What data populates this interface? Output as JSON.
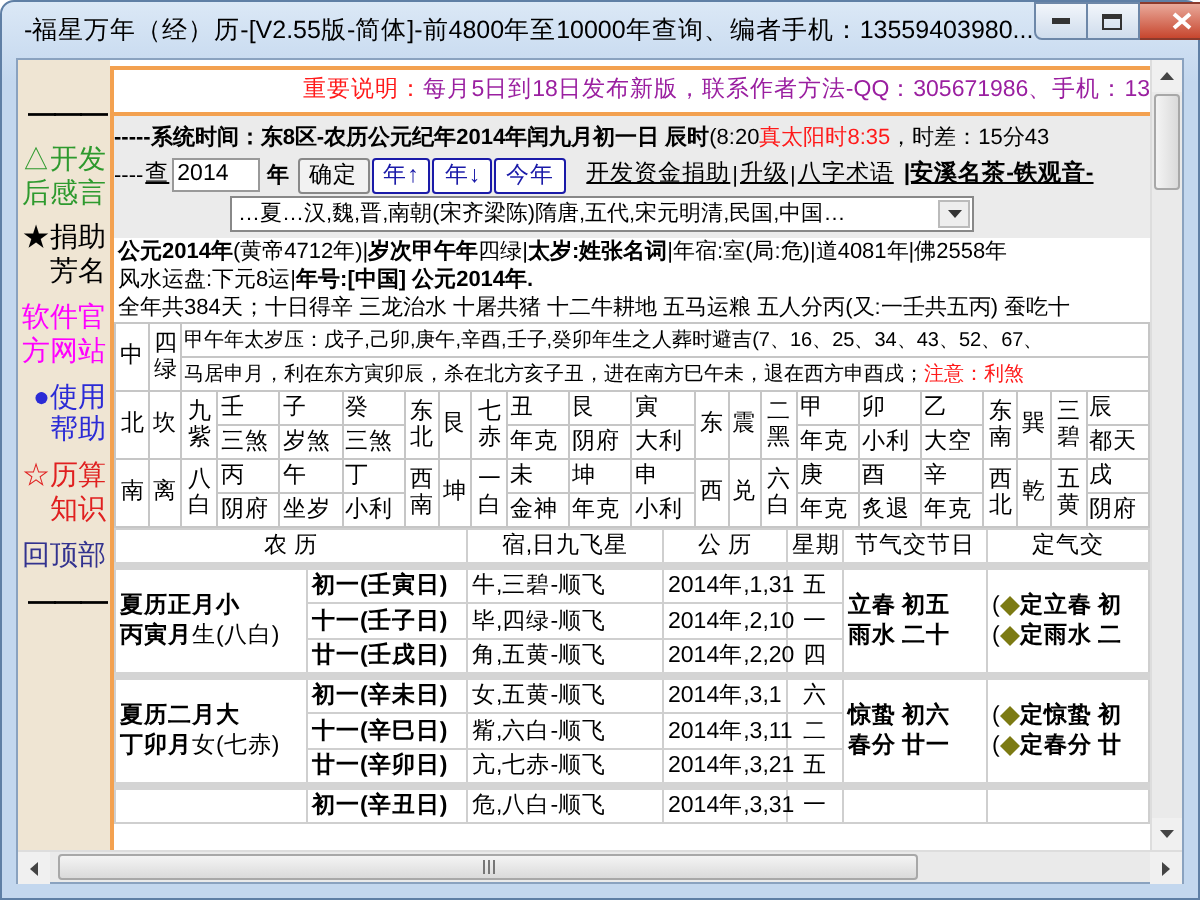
{
  "window": {
    "title": "-福星万年（经）历-[V2.55版-简体]-前4800年至10000年查询、编者手机：13559403980..."
  },
  "sidebar": {
    "items": [
      {
        "kind": "rule",
        "text": "———",
        "color": "#000000"
      },
      {
        "kind": "link",
        "text": "△开发后感言",
        "color": "#2e9a2e"
      },
      {
        "kind": "link",
        "text": "★捐助芳名",
        "color": "#000000"
      },
      {
        "kind": "link",
        "text": "软件官方网站",
        "color": "#ff00ff"
      },
      {
        "kind": "link",
        "text": "●使用帮助",
        "color": "#2b2bd6"
      },
      {
        "kind": "link",
        "text": "☆历算知识",
        "color": "#e02020"
      },
      {
        "kind": "link",
        "text": "回顶部",
        "color": "#33338f"
      },
      {
        "kind": "rule",
        "text": "———",
        "color": "#000000"
      }
    ]
  },
  "notice": {
    "label": "重要说明：",
    "text": "每月5日到18日发布新版，联系作者方法-QQ：305671986、手机：13"
  },
  "system_time": {
    "label": "-----系统时间：东8区-农历公元纪年2014年闰九月初一日 辰时",
    "clock": "(8:20",
    "solar_time": "真太阳时8:35",
    "offset": "，时差：15分43"
  },
  "query": {
    "prefix": "----",
    "label": "查",
    "year": "2014",
    "unit": "年",
    "buttons": [
      {
        "label": "确定",
        "kind": "confirm"
      },
      {
        "label": "年↑",
        "kind": "nav"
      },
      {
        "label": "年↓",
        "kind": "nav"
      },
      {
        "label": "今年",
        "kind": "nav"
      }
    ],
    "links": [
      {
        "label": "开发资金捐助",
        "separator": "|"
      },
      {
        "label": "升级",
        "separator": "|"
      },
      {
        "label": "八字术语"
      }
    ],
    "tagline": "|安溪名茶-铁观音-"
  },
  "era_select": {
    "value": "…夏…汉,魏,晋,南朝(宋齐梁陈)隋唐,五代,宋元明清,民国,中国…"
  },
  "info_lines": [
    "**公元2014年**(黄帝4712年)|**岁次甲午年**四绿|**太岁:姓张名词**|年宿:室(局:危)|道4081年|佛2558年",
    "风水运盘:下元8运|**年号:[中国] 公元2014年.**",
    "全年共384天；十日得辛 三龙治水 十屠共猪 十二牛耕地 五马运粮 五人分丙(又:一壬共五丙) 蚕吃十"
  ],
  "fengshui_grid": {
    "center": {
      "position": "中",
      "star": "四绿",
      "line": "甲午年太岁压：戊子,己卯,庚午,辛酉,壬子,癸卯年生之人葬时避吉(7、16、25、34、43、52、67、",
      "line_2": "马居申月，利在东方寅卯辰，杀在北方亥子丑，进在南方巳午未，退在西方申酉戌；",
      "warning": "注意：利煞"
    },
    "rows": [
      {
        "sectors": [
          {
            "direction": "北",
            "trigram": "坎",
            "star": "九紫",
            "mountains": [
              {
                "name": "壬",
                "omen": "三煞"
              },
              {
                "name": "子",
                "omen": "岁煞"
              },
              {
                "name": "癸",
                "omen": "三煞"
              }
            ]
          },
          {
            "direction": "东北",
            "trigram": "艮",
            "star": "七赤",
            "mountains": [
              {
                "name": "丑",
                "omen": "年克"
              },
              {
                "name": "艮",
                "omen": "阴府"
              },
              {
                "name": "寅",
                "omen": "大利"
              }
            ]
          },
          {
            "direction": "东",
            "trigram": "震",
            "star": "二黑",
            "mountains": [
              {
                "name": "甲",
                "omen": "年克"
              },
              {
                "name": "卯",
                "omen": "小利"
              },
              {
                "name": "乙",
                "omen": "大空"
              }
            ]
          },
          {
            "direction": "东南",
            "trigram": "巽",
            "star": "三碧",
            "mountains": [
              {
                "name": "辰",
                "omen": "都天"
              }
            ]
          }
        ]
      },
      {
        "sectors": [
          {
            "direction": "南",
            "trigram": "离",
            "star": "八白",
            "mountains": [
              {
                "name": "丙",
                "omen": "阴府"
              },
              {
                "name": "午",
                "omen": "坐岁"
              },
              {
                "name": "丁",
                "omen": "小利"
              }
            ]
          },
          {
            "direction": "西南",
            "trigram": "坤",
            "star": "一白",
            "mountains": [
              {
                "name": "未",
                "omen": "金神"
              },
              {
                "name": "坤",
                "omen": "年克"
              },
              {
                "name": "申",
                "omen": "小利"
              }
            ]
          },
          {
            "direction": "西",
            "trigram": "兑",
            "star": "六白",
            "mountains": [
              {
                "name": "庚",
                "omen": "年克"
              },
              {
                "name": "酉",
                "omen": "炙退"
              },
              {
                "name": "辛",
                "omen": "年克"
              }
            ]
          },
          {
            "direction": "西北",
            "trigram": "乾",
            "star": "五黄",
            "mountains": [
              {
                "name": "戌",
                "omen": "阴府"
              }
            ]
          }
        ]
      }
    ]
  },
  "calendar_table": {
    "columns": [
      "农 历",
      "宿,日九飞星",
      "公 历",
      "星期",
      "节气交节日",
      "定气交"
    ],
    "months": [
      {
        "title": "夏历正月小",
        "subtitle": "**丙寅月**生(八白)",
        "days": [
          {
            "lunar": "初一(壬寅日)",
            "xiu_star": "牛,三碧-顺飞",
            "solar": "2014年,1,31",
            "weekday": "五"
          },
          {
            "lunar": "十一(壬子日)",
            "xiu_star": "毕,四绿-顺飞",
            "solar": "2014年,2,10",
            "weekday": "一"
          },
          {
            "lunar": "廿一(壬戌日)",
            "xiu_star": "角,五黄-顺飞",
            "solar": "2014年,2,20",
            "weekday": "四"
          }
        ],
        "terms": [
          "立春  初五",
          "雨水  二十"
        ],
        "fixed_terms": [
          {
            "prefix": "(",
            "text": "定立春  初"
          },
          {
            "prefix": "(",
            "text": "定雨水  二"
          }
        ]
      },
      {
        "title": "夏历二月大",
        "subtitle": "**丁卯月**女(七赤)",
        "days": [
          {
            "lunar": "初一(辛未日)",
            "xiu_star": "女,五黄-顺飞",
            "solar": "2014年,3,1",
            "weekday": "六"
          },
          {
            "lunar": "十一(辛巳日)",
            "xiu_star": "觜,六白-顺飞",
            "solar": "2014年,3,11",
            "weekday": "二"
          },
          {
            "lunar": "廿一(辛卯日)",
            "xiu_star": "亢,七赤-顺飞",
            "solar": "2014年,3,21",
            "weekday": "五"
          }
        ],
        "terms": [
          "惊蛰  初六",
          "春分  廿一"
        ],
        "fixed_terms": [
          {
            "prefix": "(",
            "text": "定惊蛰  初"
          },
          {
            "prefix": "(",
            "text": "定春分  廿"
          }
        ]
      },
      {
        "days": [
          {
            "lunar": "初一(辛丑日)",
            "xiu_star": "危,八白-顺飞",
            "solar": "2014年,3,31",
            "weekday": "一"
          }
        ]
      }
    ]
  }
}
